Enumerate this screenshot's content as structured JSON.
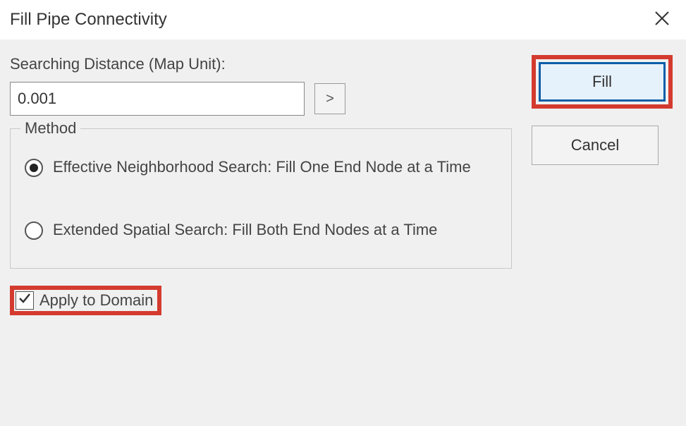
{
  "titlebar": {
    "title": "Fill Pipe Connectivity"
  },
  "form": {
    "searching_distance_label": "Searching Distance (Map Unit):",
    "searching_distance_value": "0.001",
    "pick_button_label": ">",
    "method_legend": "Method",
    "radio_options": [
      {
        "label": "Effective Neighborhood Search: Fill One End Node at a Time",
        "selected": true
      },
      {
        "label": "Extended Spatial Search: Fill Both End Nodes at a Time",
        "selected": false
      }
    ],
    "apply_to_domain_label": "Apply to Domain",
    "apply_to_domain_checked": true
  },
  "buttons": {
    "fill": "Fill",
    "cancel": "Cancel"
  }
}
